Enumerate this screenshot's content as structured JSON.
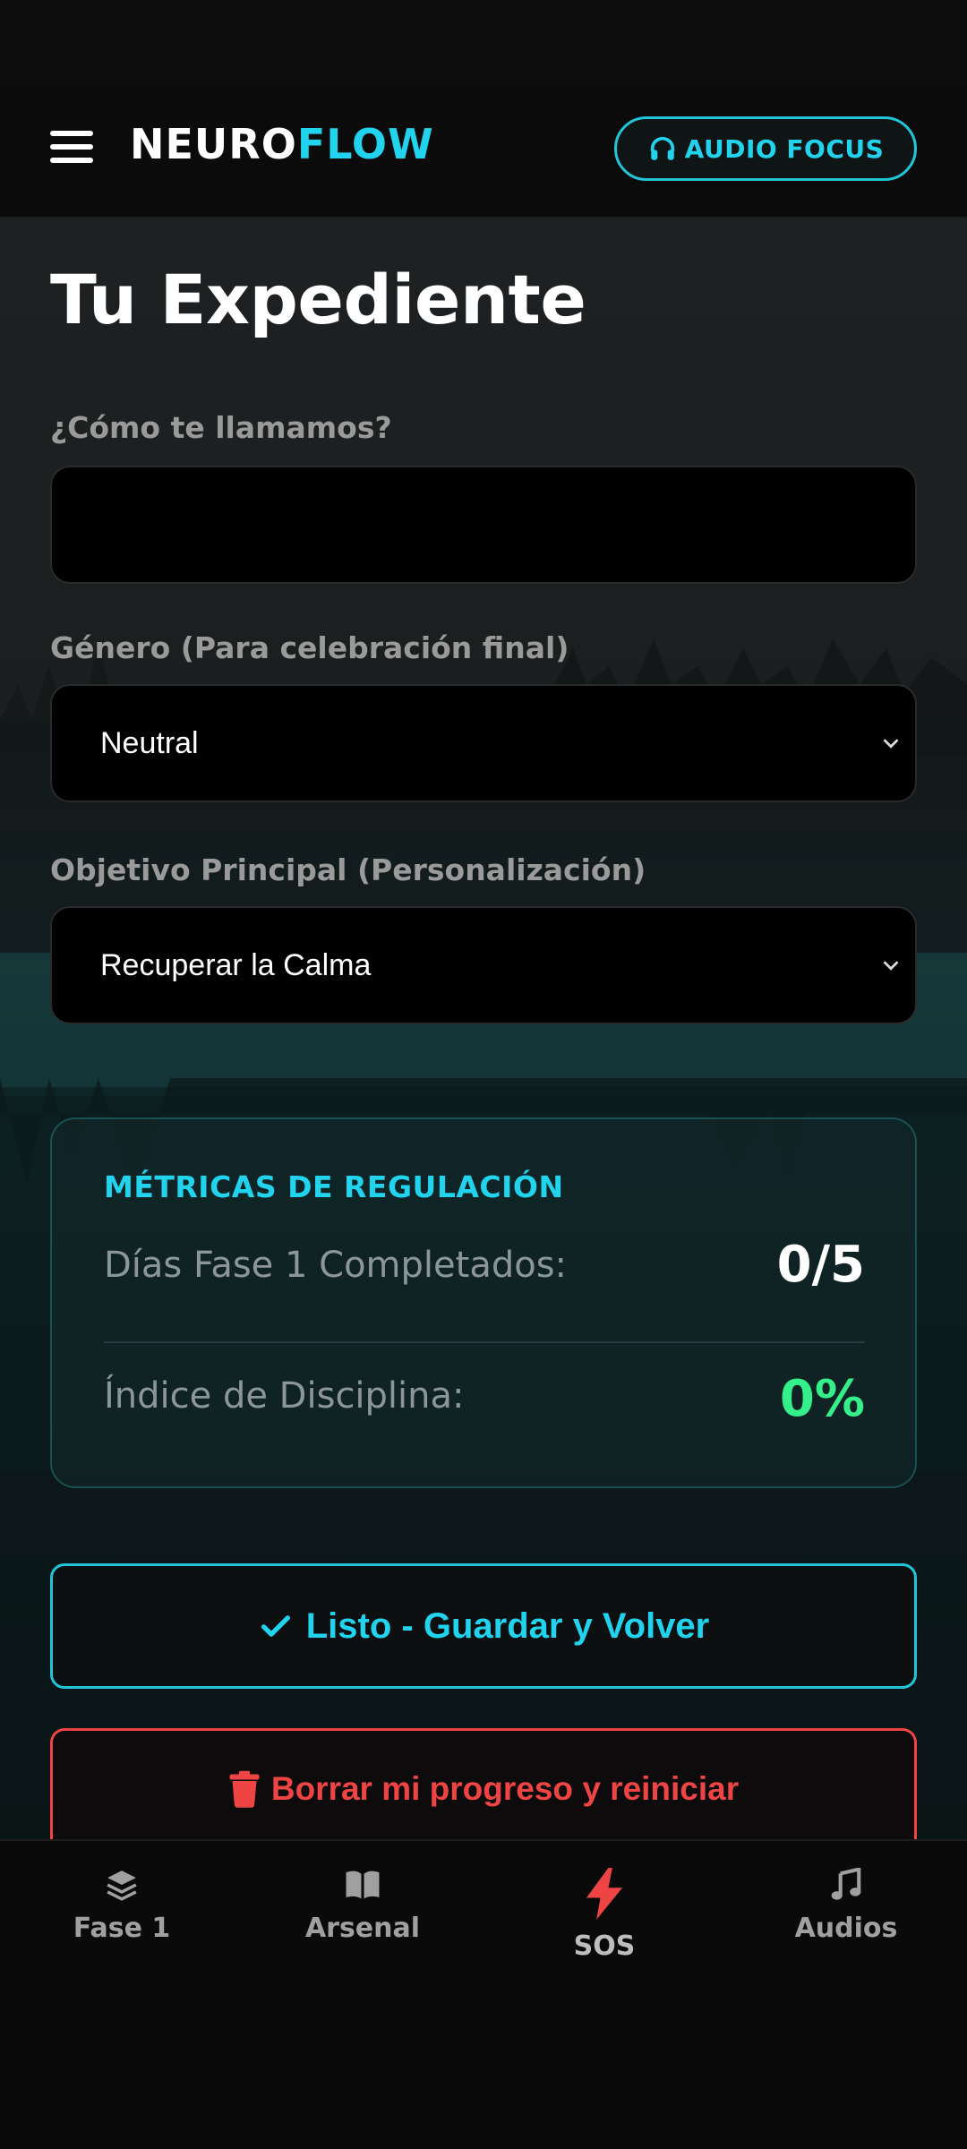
{
  "header": {
    "logo_part1": "NEURO",
    "logo_part2": "FLOW",
    "audio_button": "AUDIO FOCUS"
  },
  "page": {
    "title": "Tu Expediente"
  },
  "form": {
    "name_label": "¿Cómo te llamamos?",
    "name_value": "",
    "gender_label": "Género (Para celebración final)",
    "gender_value": "Neutral",
    "goal_label": "Objetivo Principal (Personalización)",
    "goal_value": "Recuperar la Calma"
  },
  "metrics": {
    "title": "MÉTRICAS DE REGULACIÓN",
    "days_label": "Días Fase 1 Completados:",
    "days_value": "0/5",
    "discipline_label": "Índice de Disciplina:",
    "discipline_value": "0%"
  },
  "actions": {
    "save_label": "Listo - Guardar y Volver",
    "reset_label": "Borrar mi progreso y reiniciar"
  },
  "nav": {
    "items": [
      {
        "label": "Fase 1",
        "icon": "layers-icon"
      },
      {
        "label": "Arsenal",
        "icon": "book-icon"
      },
      {
        "label": "SOS",
        "icon": "bolt-icon"
      },
      {
        "label": "Audios",
        "icon": "music-icon"
      }
    ]
  },
  "colors": {
    "accent": "#22d3ee",
    "success": "#34ef8a",
    "danger": "#ef4444"
  }
}
